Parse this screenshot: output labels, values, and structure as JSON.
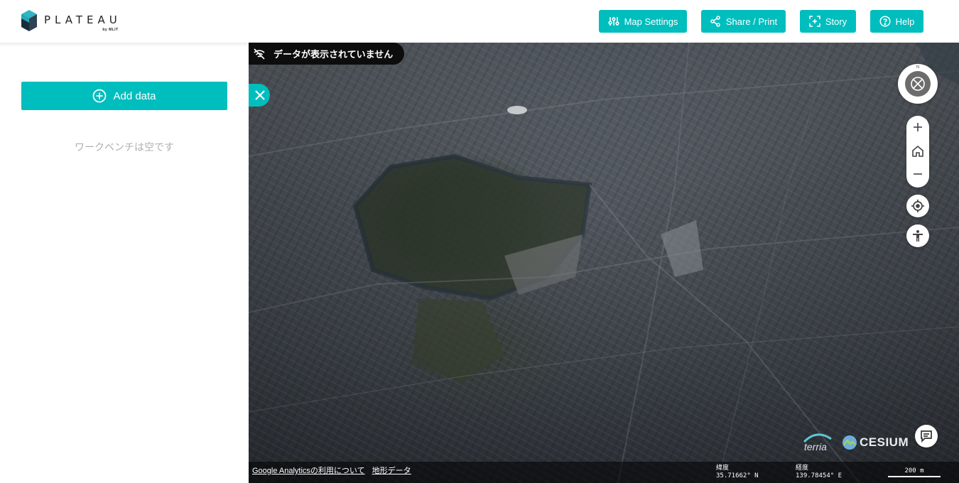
{
  "header": {
    "logo_name": "PLATEAU",
    "logo_sub": "by MLIT",
    "buttons": {
      "map_settings": "Map Settings",
      "share_print": "Share / Print",
      "story": "Story",
      "help": "Help"
    }
  },
  "panel": {
    "add_data_label": "Add data",
    "empty_message": "ワークベンチは空です"
  },
  "map": {
    "no_data_message": "データが表示されていません",
    "compass_north": "N",
    "attribution_links": [
      "Google Analyticsの利用について",
      "地形データ"
    ],
    "latitude_label": "緯度",
    "latitude_value": "35.71662° N",
    "longitude_label": "経度",
    "longitude_value": "139.78454° E",
    "scale_label": "200 m",
    "logos": {
      "terria": "terria",
      "cesium": "CESIUM"
    }
  },
  "colors": {
    "accent": "#00bebe",
    "header_bg": "#ffffff",
    "pill_bg": "#0d0d0d"
  },
  "icons": {
    "logo": "plateau-cube-icon",
    "map_settings": "sliders-icon",
    "share": "share-icon",
    "story": "story-capture-icon",
    "help": "question-circle-icon",
    "add_data": "plus-circle-icon",
    "no_data": "signal-off-icon",
    "close_panel": "close-icon",
    "compass": "compass-icon",
    "zoom_in": "plus-icon",
    "home": "home-icon",
    "zoom_out": "minus-icon",
    "locate": "crosshair-icon",
    "accessibility": "accessibility-icon",
    "feedback": "feedback-icon"
  }
}
